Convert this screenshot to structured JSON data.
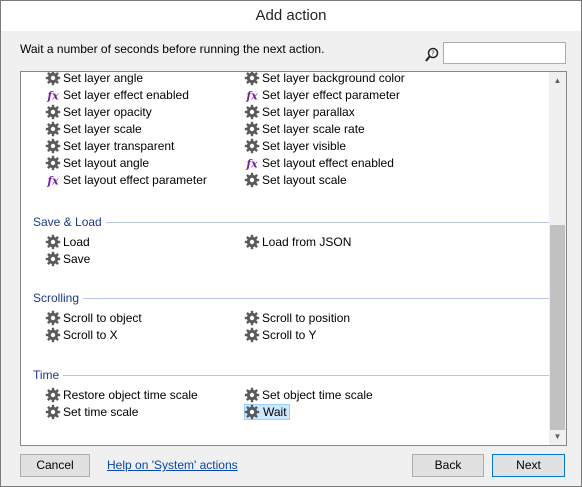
{
  "window": {
    "title": "Add action"
  },
  "header": {
    "description": "Wait a number of seconds before running the next action.",
    "search": {
      "value": "",
      "placeholder": ""
    }
  },
  "categories": [
    {
      "title": "",
      "items": [
        {
          "label": "Set layer angle",
          "icon": "gear-icon"
        },
        {
          "label": "Set layer background color",
          "icon": "gear-icon"
        },
        {
          "label": "Set layer effect enabled",
          "icon": "fx-icon"
        },
        {
          "label": "Set layer effect parameter",
          "icon": "fx-icon"
        },
        {
          "label": "Set layer opacity",
          "icon": "gear-icon"
        },
        {
          "label": "Set layer parallax",
          "icon": "gear-icon"
        },
        {
          "label": "Set layer scale",
          "icon": "gear-icon"
        },
        {
          "label": "Set layer scale rate",
          "icon": "gear-icon"
        },
        {
          "label": "Set layer transparent",
          "icon": "gear-icon"
        },
        {
          "label": "Set layer visible",
          "icon": "gear-icon"
        },
        {
          "label": "Set layout angle",
          "icon": "gear-icon"
        },
        {
          "label": "Set layout effect enabled",
          "icon": "fx-icon"
        },
        {
          "label": "Set layout effect parameter",
          "icon": "fx-icon"
        },
        {
          "label": "Set layout scale",
          "icon": "gear-icon"
        }
      ]
    },
    {
      "title": "Save & Load",
      "items": [
        {
          "label": "Load",
          "icon": "gear-icon"
        },
        {
          "label": "Load from JSON",
          "icon": "gear-icon"
        },
        {
          "label": "Save",
          "icon": "gear-icon"
        }
      ]
    },
    {
      "title": "Scrolling",
      "items": [
        {
          "label": "Scroll to object",
          "icon": "gear-icon"
        },
        {
          "label": "Scroll to position",
          "icon": "gear-icon"
        },
        {
          "label": "Scroll to X",
          "icon": "gear-icon"
        },
        {
          "label": "Scroll to Y",
          "icon": "gear-icon"
        }
      ]
    },
    {
      "title": "Time",
      "items": [
        {
          "label": "Restore object time scale",
          "icon": "gear-icon"
        },
        {
          "label": "Set object time scale",
          "icon": "gear-icon"
        },
        {
          "label": "Set time scale",
          "icon": "gear-icon"
        },
        {
          "label": "Wait",
          "icon": "gear-icon",
          "selected": true
        }
      ]
    }
  ],
  "footer": {
    "cancel_label": "Cancel",
    "help_link": "Help on 'System' actions",
    "back_label": "Back",
    "next_label": "Next"
  },
  "colors": {
    "category_title": "#1e3a8a",
    "selection_bg": "#cce8ff",
    "link": "#0645ad",
    "fx_icon": "#7a1fa2",
    "gear_icon": "#5a5a5a"
  }
}
